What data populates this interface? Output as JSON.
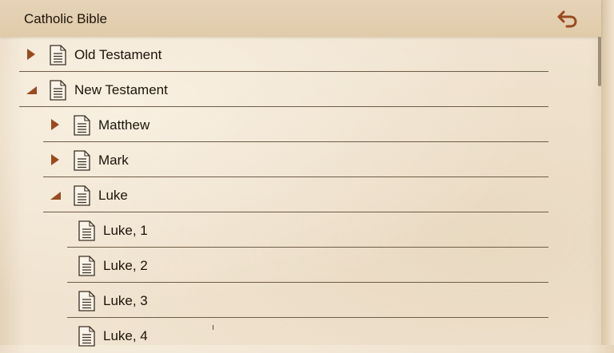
{
  "app": {
    "title": "Catholic Bible"
  },
  "toolbar": {
    "back_icon": "undo-arrow-icon"
  },
  "colors": {
    "accent": "#9a4a1f",
    "line": "#6e5d47",
    "paper": "#f0e3cf"
  },
  "tree": {
    "items": [
      {
        "label": "Old Testament",
        "level": 0,
        "state": "collapsed"
      },
      {
        "label": "New Testament",
        "level": 0,
        "state": "expanded"
      },
      {
        "label": "Matthew",
        "level": 1,
        "state": "collapsed"
      },
      {
        "label": "Mark",
        "level": 1,
        "state": "collapsed"
      },
      {
        "label": "Luke",
        "level": 1,
        "state": "expanded"
      },
      {
        "label": "Luke, 1",
        "level": 2,
        "state": "leaf"
      },
      {
        "label": "Luke, 2",
        "level": 2,
        "state": "leaf"
      },
      {
        "label": "Luke, 3",
        "level": 2,
        "state": "leaf"
      },
      {
        "label": "Luke, 4",
        "level": 2,
        "state": "leaf"
      }
    ]
  }
}
